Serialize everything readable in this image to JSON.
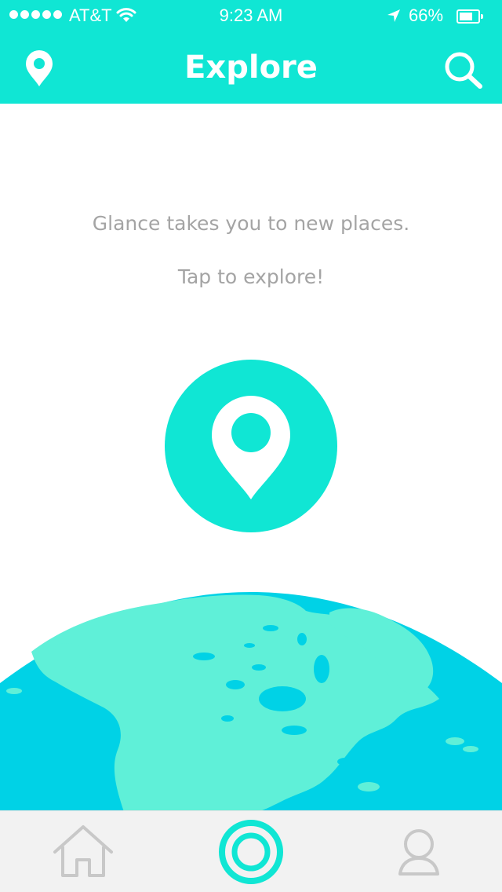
{
  "status_bar": {
    "carrier": "AT&T",
    "time": "9:23 AM",
    "battery": "66%",
    "icons": [
      "signal-dots",
      "wifi-icon",
      "location-arrow-icon",
      "battery-icon"
    ]
  },
  "nav": {
    "title": "Explore",
    "left_icon": "location-pin-icon",
    "right_icon": "search-icon"
  },
  "main": {
    "intro": "Glance takes you to new places.",
    "cta": "Tap to explore!",
    "button_icon": "location-pin-icon"
  },
  "tab_bar": {
    "tabs": [
      {
        "icon": "home-icon",
        "selected": false
      },
      {
        "icon": "explore-ring-icon",
        "selected": true
      },
      {
        "icon": "user-icon",
        "selected": false
      }
    ]
  },
  "colors": {
    "accent": "#10e6d4",
    "ocean": "#00d2e6",
    "land": "#5ff0d8",
    "text_muted": "#a4a4a4",
    "tab_bar_bg": "#f2f2f2",
    "tab_icon_inactive": "#c8c8c8"
  }
}
